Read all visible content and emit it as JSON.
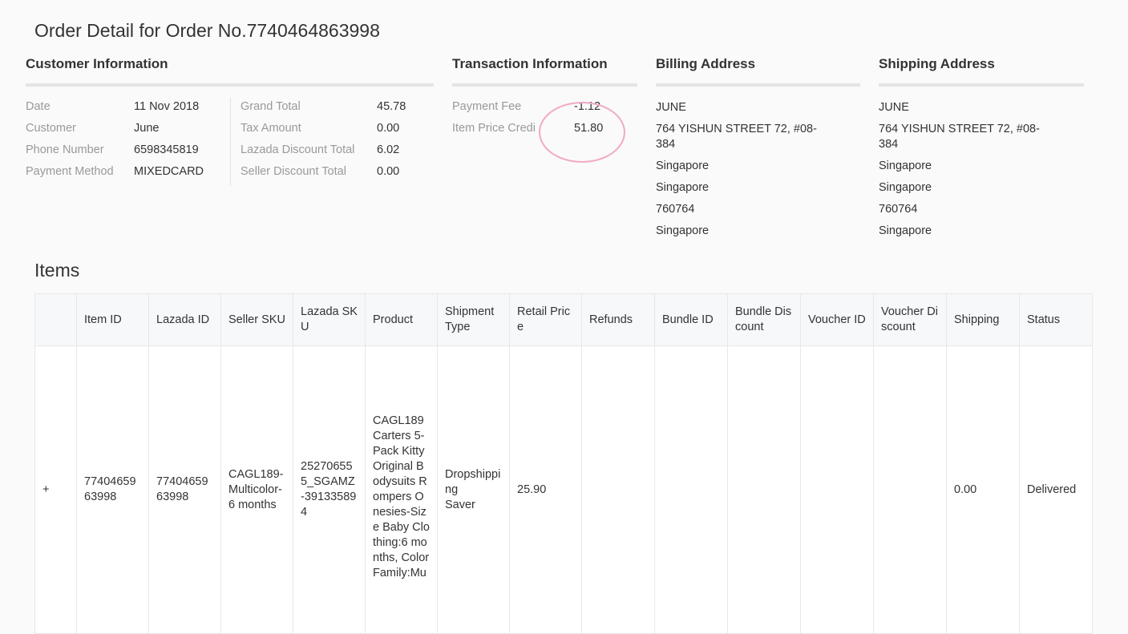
{
  "page_title": "Order Detail for Order No.7740464863998",
  "customer": {
    "title": "Customer Information",
    "date_label": "Date",
    "date": "11 Nov 2018",
    "customer_label": "Customer",
    "customer": "June",
    "phone_label": "Phone Number",
    "phone": "6598345819",
    "payment_label": "Payment Method",
    "payment": "MIXEDCARD",
    "grand_total_label": "Grand Total",
    "grand_total": "45.78",
    "tax_label": "Tax Amount",
    "tax": "0.00",
    "lazada_discount_label": "Lazada Discount Total",
    "lazada_discount": "6.02",
    "seller_discount_label": "Seller Discount Total",
    "seller_discount": "0.00"
  },
  "transaction": {
    "title": "Transaction Information",
    "payment_fee_label": "Payment Fee",
    "payment_fee": "-1.12",
    "item_price_credit_label": "Item Price Credi",
    "item_price_credit": "51.80"
  },
  "billing": {
    "title": "Billing Address",
    "name": "JUNE",
    "street": "764 YISHUN STREET 72, #08-384",
    "city": "Singapore",
    "state": "Singapore",
    "postcode": "760764",
    "country": "Singapore"
  },
  "shipping": {
    "title": "Shipping Address",
    "name": "JUNE",
    "street": "764 YISHUN STREET 72, #08-384",
    "city": "Singapore",
    "state": "Singapore",
    "postcode": "760764",
    "country": "Singapore"
  },
  "items": {
    "title": "Items",
    "headers": {
      "item_id": "Item ID",
      "lazada_id": "Lazada ID",
      "seller_sku": "Seller SKU",
      "lazada_sku": "Lazada SKU",
      "product": "Product",
      "shipment_type": "Shipment Type",
      "retail_price": "Retail Price",
      "refunds": "Refunds",
      "bundle_id": "Bundle ID",
      "bundle_discount": "Bundle Discount",
      "voucher_id": "Voucher ID",
      "voucher_discount": "Voucher Discount",
      "shipping": "Shipping",
      "status": "Status"
    },
    "rows": [
      {
        "expand": "+",
        "item_id": "7740465963998",
        "lazada_id": "7740465963998",
        "seller_sku": "CAGL189-Multicolor-6 months",
        "lazada_sku": "252706555_SGAMZ-391335894",
        "product": "CAGL189 Carters 5-Pack Kitty Original Bodysuits Rompers Onesies-Size Baby Clothing:6 months, Color Family:Mu",
        "shipment_type_line1": "Dropshipping",
        "shipment_type_line2": "Saver",
        "retail_price": "25.90",
        "refunds": "",
        "bundle_id": "",
        "bundle_discount": "",
        "voucher_id": "",
        "voucher_discount": "",
        "shipping": "0.00",
        "status": "Delivered"
      }
    ]
  }
}
